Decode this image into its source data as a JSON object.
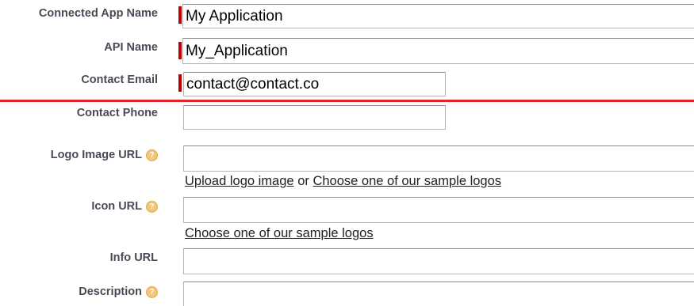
{
  "form": {
    "connected_app_name": {
      "label": "Connected App Name",
      "value": "My Application",
      "required": true
    },
    "api_name": {
      "label": "API Name",
      "value": "My_Application",
      "required": true
    },
    "contact_email": {
      "label": "Contact Email",
      "value": "contact@contact.co",
      "required": true
    },
    "contact_phone": {
      "label": "Contact Phone",
      "value": ""
    },
    "logo_image_url": {
      "label": "Logo Image URL",
      "value": "",
      "upload_link": "Upload logo image",
      "or_text": "or",
      "sample_link": "Choose one of our sample logos"
    },
    "icon_url": {
      "label": "Icon URL",
      "value": "",
      "sample_link": "Choose one of our sample logos"
    },
    "info_url": {
      "label": "Info URL",
      "value": ""
    },
    "description": {
      "label": "Description",
      "value": ""
    }
  },
  "icons": {
    "help": "help-icon"
  },
  "colors": {
    "required_bar": "#c00000",
    "divider": "#e3232b",
    "label_text": "#4a4a56",
    "help_icon": "#f0c67e"
  }
}
